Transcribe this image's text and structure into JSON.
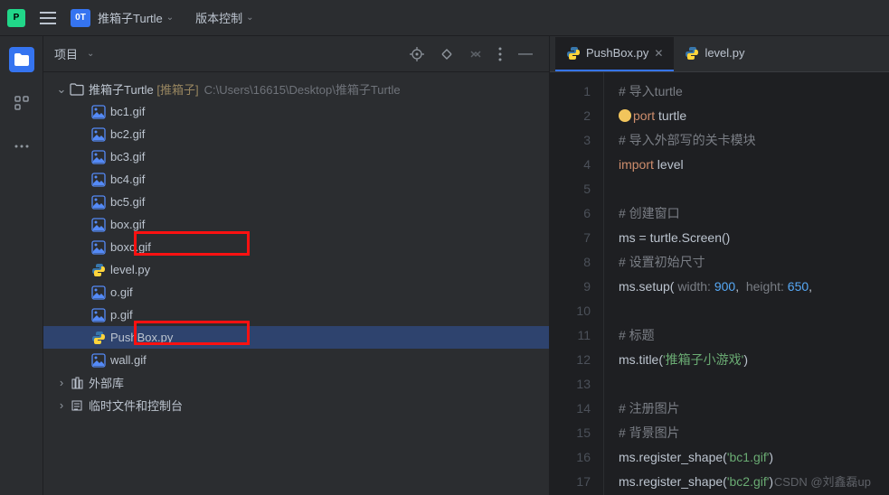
{
  "titlebar": {
    "project_badge": "0T",
    "project_name": "推箱子Turtle",
    "vcs_label": "版本控制"
  },
  "project": {
    "title": "项目",
    "root_name": "推箱子Turtle",
    "root_bracket": "[推箱子]",
    "root_path": "C:\\Users\\16615\\Desktop\\推箱子Turtle",
    "files": [
      {
        "name": "bc1.gif",
        "type": "img"
      },
      {
        "name": "bc2.gif",
        "type": "img"
      },
      {
        "name": "bc3.gif",
        "type": "img"
      },
      {
        "name": "bc4.gif",
        "type": "img"
      },
      {
        "name": "bc5.gif",
        "type": "img"
      },
      {
        "name": "box.gif",
        "type": "img"
      },
      {
        "name": "boxc.gif",
        "type": "img"
      },
      {
        "name": "level.py",
        "type": "py"
      },
      {
        "name": "o.gif",
        "type": "img"
      },
      {
        "name": "p.gif",
        "type": "img"
      },
      {
        "name": "PushBox.py",
        "type": "py",
        "selected": true
      },
      {
        "name": "wall.gif",
        "type": "img"
      }
    ],
    "ext_lib": "外部库",
    "scratch": "临时文件和控制台"
  },
  "tabs": [
    {
      "label": "PushBox.py",
      "active": true
    },
    {
      "label": "level.py",
      "active": false
    }
  ],
  "code": {
    "lines": [
      {
        "n": 1,
        "html": "<span class='cm'># 导入turtle</span>"
      },
      {
        "n": 2,
        "html": "<span class='bulb'></span><span class='kw'>port</span> turtle"
      },
      {
        "n": 3,
        "html": "<span class='cm'># 导入外部写的关卡模块</span>"
      },
      {
        "n": 4,
        "html": "<span class='kw'>import</span> level"
      },
      {
        "n": 5,
        "html": ""
      },
      {
        "n": 6,
        "html": "<span class='cm'># 创建窗口</span>"
      },
      {
        "n": 7,
        "html": "ms = turtle.Screen()"
      },
      {
        "n": 8,
        "html": "<span class='cm'># 设置初始尺寸</span>"
      },
      {
        "n": 9,
        "html": "ms.setup( <span class='param'>width:</span> <span class='num'>900</span>,  <span class='param'>height:</span> <span class='num'>650</span>,"
      },
      {
        "n": 10,
        "html": ""
      },
      {
        "n": 11,
        "html": "<span class='cm'># 标题</span>"
      },
      {
        "n": 12,
        "html": "ms.title(<span class='str'>'推箱子小游戏'</span>)"
      },
      {
        "n": 13,
        "html": ""
      },
      {
        "n": 14,
        "html": "<span class='cm'># 注册图片</span>"
      },
      {
        "n": 15,
        "html": "<span class='cm'># 背景图片</span>"
      },
      {
        "n": 16,
        "html": "ms.register_shape(<span class='str'>'bc1.gif'</span>)"
      },
      {
        "n": 17,
        "html": "ms.register_shape(<span class='str'>'bc2.gif'</span>)"
      }
    ]
  },
  "watermark": "CSDN @刘鑫磊up"
}
